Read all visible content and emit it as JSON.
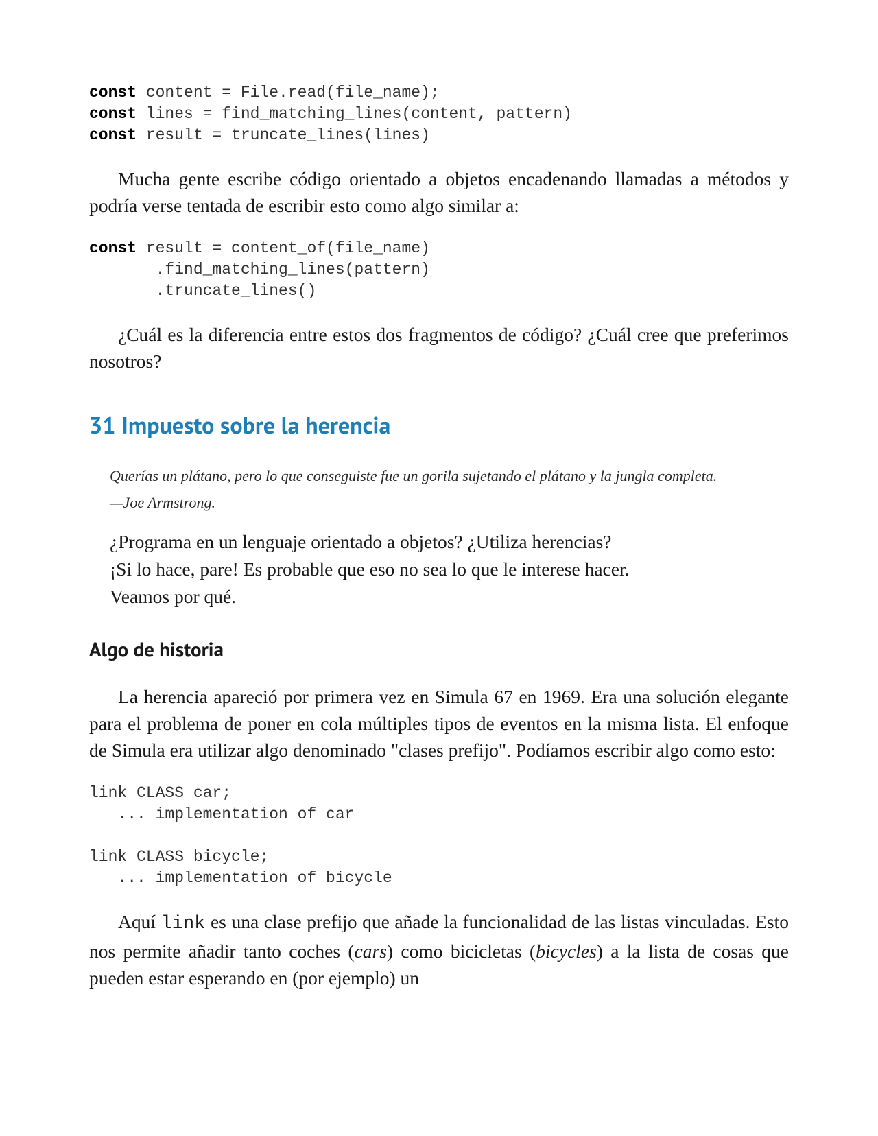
{
  "code1": {
    "l1a": "const",
    "l1b": " content = File.read(file_name);",
    "l2a": "const",
    "l2b": " lines = find_matching_lines(content, pattern)",
    "l3a": "const",
    "l3b": " result = truncate_lines(lines)"
  },
  "para1": "Mucha gente escribe código orientado a objetos encadenando llamadas a métodos y podría verse tentada de escribir esto como algo similar a:",
  "code2": {
    "l1a": "const",
    "l1b": " result = content_of(file_name)",
    "l2": "       .find_matching_lines(pattern)",
    "l3": "       .truncate_lines()"
  },
  "para2": "¿Cuál es la diferencia entre estos dos fragmentos de código? ¿Cuál cree que preferimos nosotros?",
  "section_title": "31 Impuesto sobre la herencia",
  "epigraph": {
    "quote": "Querías un plátano, pero lo que conseguiste fue un gorila sujetando el plátano y la jungla completa.",
    "attr": "—Joe Armstrong."
  },
  "intro": {
    "l1": "¿Programa en un lenguaje orientado a objetos? ¿Utiliza herencias?",
    "l2": "¡Si lo hace, pare! Es probable que eso no sea lo que le interese hacer.",
    "l3": "Veamos por qué."
  },
  "subsection_title": "Algo de historia",
  "para3": "La herencia apareció por primera vez en Simula 67 en 1969. Era una solución elegante para el problema de poner en cola múltiples tipos de eventos en la misma lista. El enfoque de Simula era utilizar algo denominado \"clases prefijo\". Podíamos escribir algo como esto:",
  "code3": {
    "l1": "link CLASS car;",
    "l2": "   ... implementation of car",
    "l3": "",
    "l4": "link CLASS bicycle;",
    "l5": "   ... implementation of bicycle"
  },
  "para4_pre": "Aquí ",
  "para4_code": "link",
  "para4_mid1": " es una clase prefijo que añade la funcionalidad de las listas vinculadas. Esto nos permite añadir tanto coches (",
  "para4_em1": "cars",
  "para4_mid2": ") como bicicletas (",
  "para4_em2": "bicycles",
  "para4_post": ") a la lista de cosas que pueden estar esperando en (por ejemplo) un"
}
